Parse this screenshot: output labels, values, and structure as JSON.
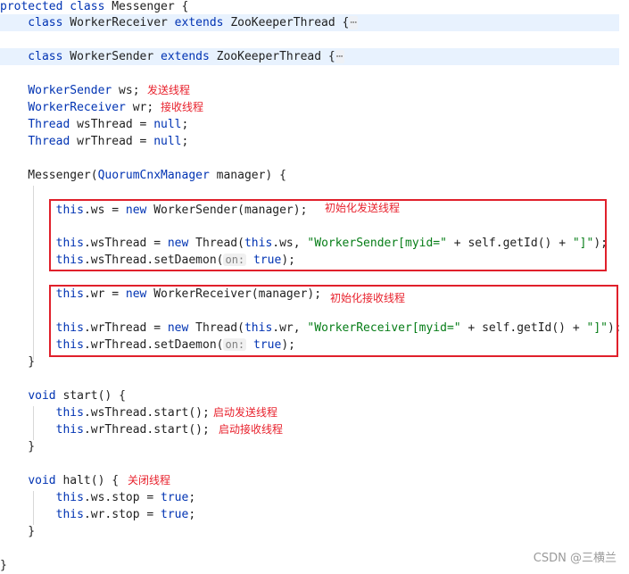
{
  "code": {
    "l01": {
      "a": "protected class",
      "b": " Messenger {"
    },
    "l02": {
      "a": "    class ",
      "b": "WorkerReceiver",
      "c": " extends ",
      "d": "ZooKeeperThread",
      "e": " {",
      "f": "⋯"
    },
    "l03": {
      "a": "    class ",
      "b": "WorkerSender",
      "c": " extends ",
      "d": "ZooKeeperThread",
      "e": " {",
      "f": "⋯"
    },
    "l04": {
      "a": "    ",
      "b": "WorkerSender",
      "c": " ws;"
    },
    "l05": {
      "a": "    ",
      "b": "WorkerReceiver",
      "c": " wr;"
    },
    "l06": {
      "a": "    ",
      "b": "Thread",
      "c": " wsThread = ",
      "d": "null",
      "e": ";"
    },
    "l07": {
      "a": "    ",
      "b": "Thread",
      "c": " wrThread = ",
      "d": "null",
      "e": ";"
    },
    "l08": {
      "a": "    Messenger(",
      "b": "QuorumCnxManager",
      "c": " manager) {"
    },
    "l09": {
      "a": "        ",
      "b": "this",
      "c": ".ws = ",
      "d": "new",
      "e": " WorkerSender(manager);"
    },
    "l10": {
      "a": "        ",
      "b": "this",
      "c": ".wsThread = ",
      "d": "new",
      "e": " Thread(",
      "f": "this",
      "g": ".ws, ",
      "h": "\"WorkerSender[myid=\"",
      "i": " + self.getId() + ",
      "j": "\"]\"",
      "k": ");"
    },
    "l11": {
      "a": "        ",
      "b": "this",
      "c": ".wsThread.setDaemon(",
      "d": "on:",
      "e": " ",
      "f": "true",
      "g": ");"
    },
    "l12": {
      "a": "        ",
      "b": "this",
      "c": ".wr = ",
      "d": "new",
      "e": " WorkerReceiver(manager);"
    },
    "l13": {
      "a": "        ",
      "b": "this",
      "c": ".wrThread = ",
      "d": "new",
      "e": " Thread(",
      "f": "this",
      "g": ".wr, ",
      "h": "\"WorkerReceiver[myid=\"",
      "i": " + self.getId() + ",
      "j": "\"]\"",
      "k": ");"
    },
    "l14": {
      "a": "        ",
      "b": "this",
      "c": ".wrThread.setDaemon(",
      "d": "on:",
      "e": " ",
      "f": "true",
      "g": ");"
    },
    "l15": {
      "a": "    }"
    },
    "l16": {
      "a": "    ",
      "b": "void",
      "c": " start() {"
    },
    "l17": {
      "a": "        ",
      "b": "this",
      "c": ".wsThread.start();"
    },
    "l18": {
      "a": "        ",
      "b": "this",
      "c": ".wrThread.start();"
    },
    "l19": {
      "a": "    }"
    },
    "l20": {
      "a": "    ",
      "b": "void",
      "c": " halt() {"
    },
    "l21": {
      "a": "        ",
      "b": "this",
      "c": ".ws.stop = ",
      "d": "true",
      "e": ";"
    },
    "l22": {
      "a": "        ",
      "b": "this",
      "c": ".wr.stop = ",
      "d": "true",
      "e": ";"
    },
    "l23": {
      "a": "    }"
    },
    "l24": {
      "a": "}"
    }
  },
  "notes": {
    "send_thread": "发送线程",
    "recv_thread": "接收线程",
    "init_send": "初始化发送线程",
    "init_recv": "初始化接收线程",
    "start_send": "启动发送线程",
    "start_recv": "启动接收线程",
    "stop_threads": "关闭线程"
  },
  "watermark": "CSDN @三横兰",
  "colors": {
    "annotation": "#e8222d",
    "keyword": "#0033b3",
    "string": "#067d17",
    "line_highlight": "#e8f2fe"
  }
}
